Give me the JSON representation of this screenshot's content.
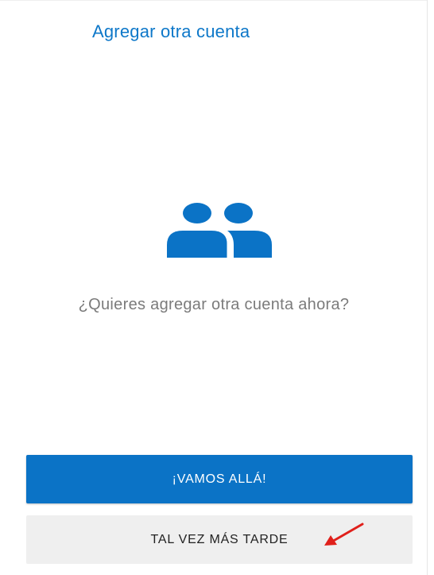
{
  "header": {
    "title": "Agregar otra cuenta"
  },
  "main": {
    "icon": "people-icon",
    "question": "¿Quieres agregar otra cuenta ahora?"
  },
  "actions": {
    "primary_label": "¡VAMOS ALLÁ!",
    "secondary_label": "TAL VEZ MÁS TARDE"
  },
  "annotation": {
    "icon": "red-arrow-icon"
  },
  "colors": {
    "accent": "#0b73c6",
    "title": "#0e78c9",
    "question_text": "#7b7b7b",
    "secondary_button": "#efefef",
    "annotation": "#e0201b"
  }
}
